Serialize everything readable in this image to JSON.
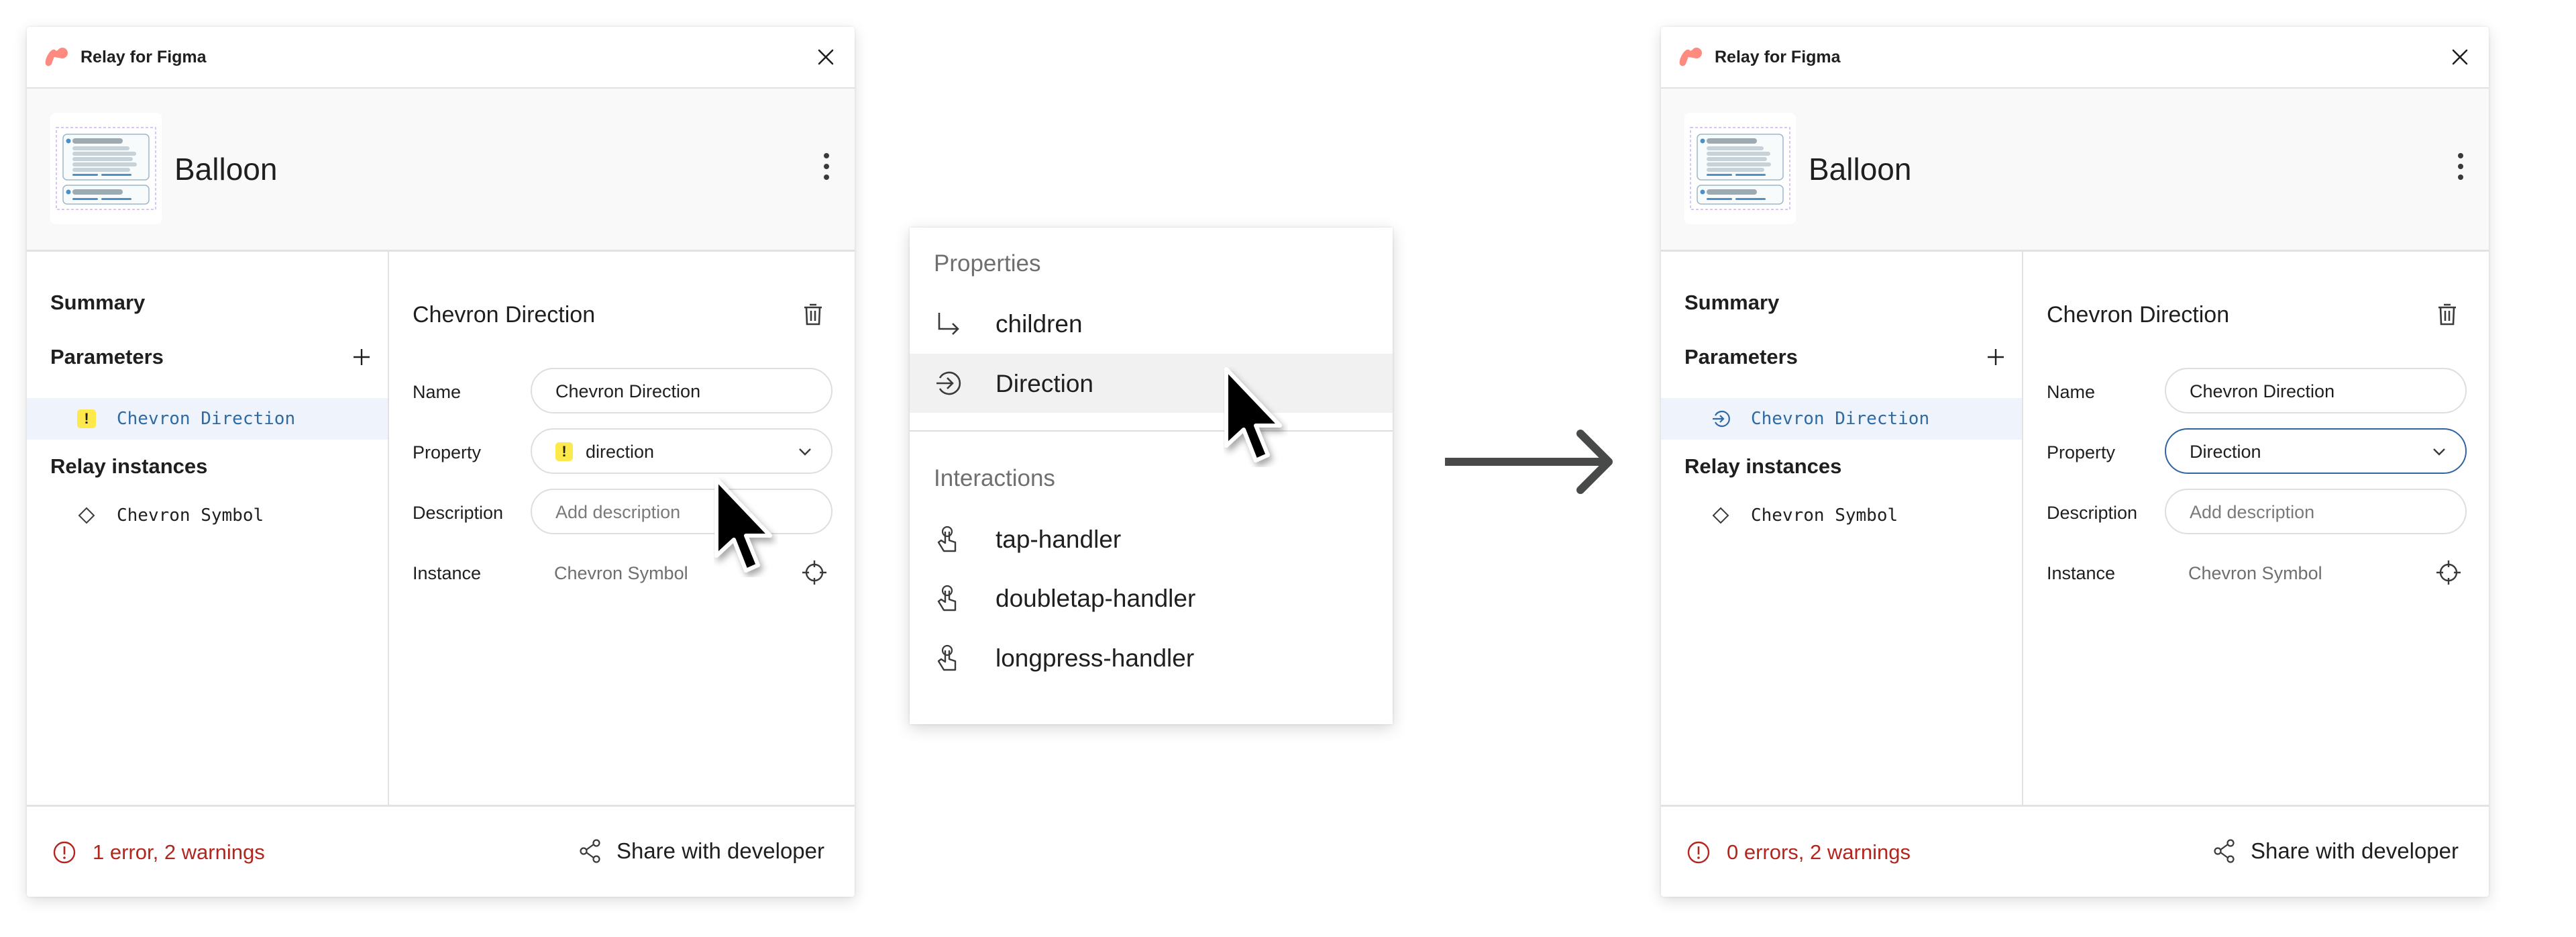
{
  "before": {
    "app_title": "Relay for Figma",
    "component_name": "Balloon",
    "summary_label": "Summary",
    "parameters_label": "Parameters",
    "parameters": [
      {
        "label": "Chevron Direction",
        "icon": "warning-badge",
        "badge_text": "!",
        "selected": true
      }
    ],
    "relay_instances_label": "Relay instances",
    "instances": [
      {
        "label": "Chevron Symbol",
        "icon": "diamond-icon"
      }
    ],
    "detail": {
      "title": "Chevron Direction",
      "name_label": "Name",
      "name_value": "Chevron Direction",
      "property_label": "Property",
      "property_value": "direction",
      "property_badge": "!",
      "description_label": "Description",
      "description_placeholder": "Add description",
      "instance_label": "Instance",
      "instance_value": "Chevron Symbol"
    },
    "footer": {
      "status": "1 error, 2 warnings",
      "share_label": "Share with developer"
    }
  },
  "menu": {
    "sections": [
      {
        "header": "Properties",
        "items": [
          {
            "label": "children",
            "icon": "subdirectory-arrow-icon"
          },
          {
            "label": "Direction",
            "icon": "input-circle-arrow-icon",
            "hovered": true
          }
        ]
      },
      {
        "header": "Interactions",
        "items": [
          {
            "label": "tap-handler",
            "icon": "touch-icon"
          },
          {
            "label": "doubletap-handler",
            "icon": "touch-icon"
          },
          {
            "label": "longpress-handler",
            "icon": "touch-icon"
          }
        ]
      }
    ]
  },
  "after": {
    "app_title": "Relay for Figma",
    "component_name": "Balloon",
    "summary_label": "Summary",
    "parameters_label": "Parameters",
    "parameters": [
      {
        "label": "Chevron Direction",
        "icon": "input-circle-arrow-icon",
        "selected": true
      }
    ],
    "relay_instances_label": "Relay instances",
    "instances": [
      {
        "label": "Chevron Symbol",
        "icon": "diamond-icon"
      }
    ],
    "detail": {
      "title": "Chevron Direction",
      "name_label": "Name",
      "name_value": "Chevron Direction",
      "property_label": "Property",
      "property_value": "Direction",
      "description_label": "Description",
      "description_placeholder": "Add description",
      "instance_label": "Instance",
      "instance_value": "Chevron Symbol"
    },
    "footer": {
      "status": "0 errors, 2 warnings",
      "share_label": "Share with developer"
    }
  },
  "colors": {
    "logo": "#ff8a80",
    "selected_row_bg": "#eff3fb",
    "selected_text": "#2f6aa3",
    "warning_badge": "#fde94b",
    "error_text": "#b3261e",
    "focus_border": "#2f64a0",
    "flow_arrow": "#474a49"
  }
}
